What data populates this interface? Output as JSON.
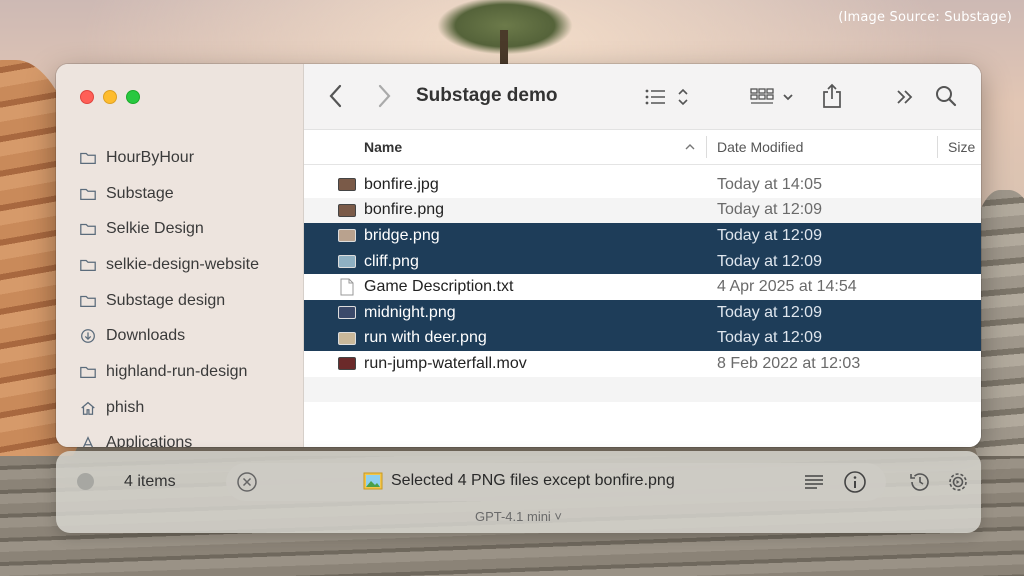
{
  "credit": "(Image Source: Substage)",
  "window": {
    "title": "Substage demo"
  },
  "sidebar": {
    "items": [
      {
        "label": "HourByHour",
        "icon": "folder-icon"
      },
      {
        "label": "Substage",
        "icon": "folder-icon"
      },
      {
        "label": "Selkie Design",
        "icon": "folder-icon"
      },
      {
        "label": "selkie-design-website",
        "icon": "folder-icon"
      },
      {
        "label": "Substage design",
        "icon": "folder-icon"
      },
      {
        "label": "Downloads",
        "icon": "download-circle-icon"
      },
      {
        "label": "highland-run-design",
        "icon": "folder-icon"
      },
      {
        "label": "phish",
        "icon": "home-icon"
      },
      {
        "label": "Applications",
        "icon": "applications-icon"
      }
    ]
  },
  "columns": {
    "name": "Name",
    "date": "Date Modified",
    "size": "Size"
  },
  "files": [
    {
      "name": "bonfire.jpg",
      "date": "Today at 14:05",
      "selected": false,
      "thumb": "#7a5a48"
    },
    {
      "name": "bonfire.png",
      "date": "Today at 12:09",
      "selected": false,
      "thumb": "#7a5a48"
    },
    {
      "name": "bridge.png",
      "date": "Today at 12:09",
      "selected": true,
      "thumb": "#b9a28e"
    },
    {
      "name": "cliff.png",
      "date": "Today at 12:09",
      "selected": true,
      "thumb": "#8fb0c2"
    },
    {
      "name": "Game Description.txt",
      "date": "4 Apr 2025 at 14:54",
      "selected": false,
      "thumb": "doc"
    },
    {
      "name": "midnight.png",
      "date": "Today at 12:09",
      "selected": true,
      "thumb": "#3b4a6a"
    },
    {
      "name": "run with deer.png",
      "date": "Today at 12:09",
      "selected": true,
      "thumb": "#c9b89a"
    },
    {
      "name": "run-jump-waterfall.mov",
      "date": "8 Feb 2022 at 12:03",
      "selected": false,
      "thumb": "#6b2a2a"
    }
  ],
  "panel": {
    "count": "4 items",
    "message": "Selected 4 PNG files except bonfire.png",
    "model": "GPT-4.1 mini ˅"
  },
  "colors": {
    "selection": "#1e3d59",
    "close": "#ff5f57",
    "minimize": "#febc2e",
    "zoom": "#28c840"
  }
}
